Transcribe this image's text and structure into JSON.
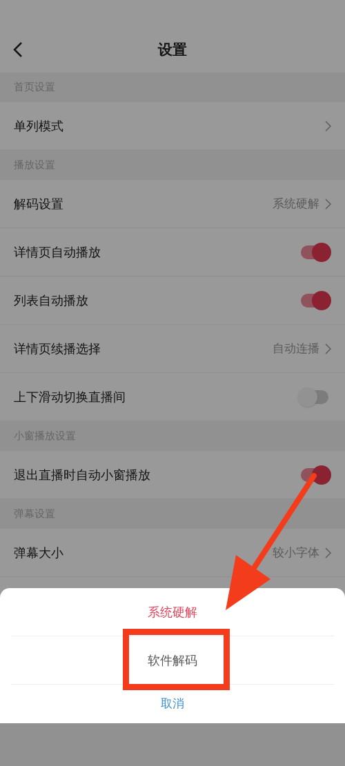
{
  "header": {
    "title": "设置"
  },
  "sections": [
    {
      "title": "首页设置",
      "items": [
        {
          "kind": "link",
          "label": "单列模式"
        }
      ]
    },
    {
      "title": "播放设置",
      "items": [
        {
          "kind": "link",
          "label": "解码设置",
          "value": "系统硬解"
        },
        {
          "kind": "toggle",
          "label": "详情页自动播放",
          "on": true
        },
        {
          "kind": "toggle",
          "label": "列表自动播放",
          "on": true
        },
        {
          "kind": "link",
          "label": "详情页续播选择",
          "value": "自动连播"
        },
        {
          "kind": "toggle",
          "label": "上下滑动切换直播间",
          "on": false
        }
      ]
    },
    {
      "title": "小窗播放设置",
      "items": [
        {
          "kind": "toggle",
          "label": "退出直播时自动小窗播放",
          "on": true
        }
      ]
    },
    {
      "title": "弹幕设置",
      "items": [
        {
          "kind": "link",
          "label": "弹幕大小",
          "value": "较小字体"
        }
      ]
    }
  ],
  "action_sheet": {
    "options": [
      {
        "label": "系统硬解",
        "selected": true
      },
      {
        "label": "软件解码",
        "selected": false
      }
    ],
    "cancel": "取消"
  }
}
